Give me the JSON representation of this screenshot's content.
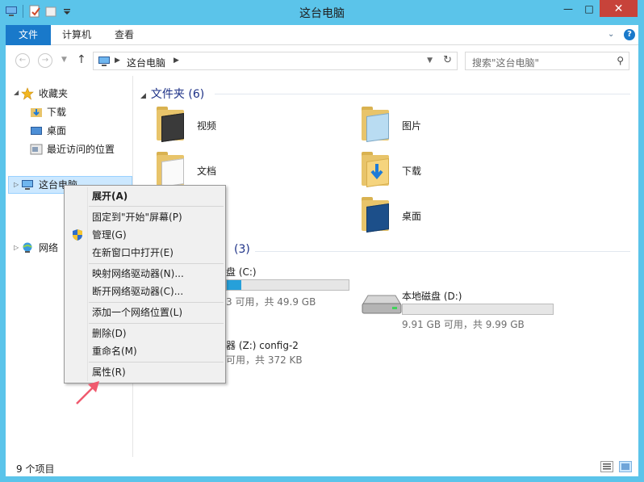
{
  "window": {
    "title": "这台电脑"
  },
  "window_buttons": {
    "minimize": "—",
    "maximize": "□",
    "close": "✕"
  },
  "ribbon": {
    "tabs": [
      {
        "label": "文件"
      },
      {
        "label": "计算机"
      },
      {
        "label": "查看"
      }
    ]
  },
  "address": {
    "crumb": "这台电脑"
  },
  "search": {
    "placeholder": "搜索\"这台电脑\""
  },
  "nav_pane": {
    "favorites": "收藏夹",
    "downloads": "下载",
    "desktop": "桌面",
    "recent": "最近访问的位置",
    "this_pc": "这台电脑",
    "network": "网络"
  },
  "content": {
    "folders_header": "文件夹 (6)",
    "folders": [
      {
        "name": "视频",
        "icon": "video-folder-icon"
      },
      {
        "name": "图片",
        "icon": "pictures-folder-icon"
      },
      {
        "name": "文档",
        "icon": "documents-folder-icon"
      },
      {
        "name": "下载",
        "icon": "downloads-folder-icon"
      },
      {
        "name": "桌面",
        "icon": "desktop-folder-icon"
      }
    ],
    "devices_header_count": "(3)",
    "drives": [
      {
        "name": "盘 (C:)",
        "free_text": "3 可用，共 49.9 GB",
        "usage": 0.12
      },
      {
        "name": "本地磁盘 (D:)",
        "free_text": "9.91 GB 可用，共 9.99 GB",
        "usage": 0.0
      },
      {
        "name": "器 (Z:) config-2",
        "free_text": "可用，共 372 KB"
      }
    ]
  },
  "status": {
    "count": "9 个项目"
  },
  "context_menu": {
    "items": [
      {
        "label": "展开(A)",
        "bold": true
      },
      {
        "label": "固定到\"开始\"屏幕(P)"
      },
      {
        "label": "管理(G)",
        "icon": "shield-icon"
      },
      {
        "label": "在新窗口中打开(E)"
      },
      {
        "label": "映射网络驱动器(N)..."
      },
      {
        "label": "断开网络驱动器(C)..."
      },
      {
        "label": "添加一个网络位置(L)"
      },
      {
        "label": "删除(D)"
      },
      {
        "label": "重命名(M)"
      },
      {
        "label": "属性(R)"
      }
    ]
  },
  "colors": {
    "accent": "#1979ca",
    "frame": "#5bc4ea",
    "close": "#c7433a",
    "arrow": "#f05a6e"
  }
}
